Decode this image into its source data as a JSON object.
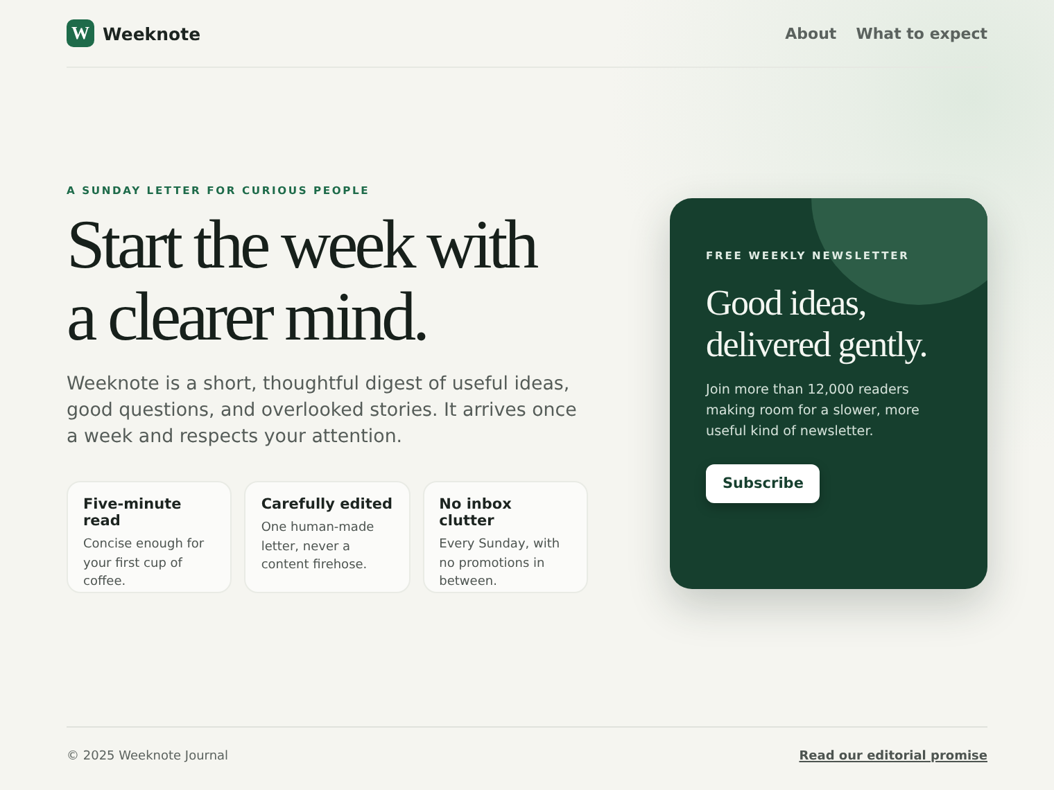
{
  "header": {
    "logo_letter": "W",
    "brand": "Weeknote",
    "nav": [
      "About",
      "What to expect"
    ]
  },
  "hero": {
    "eyebrow": "A SUNDAY LETTER FOR CURIOUS PEOPLE",
    "heading_lines": [
      "Start the week with",
      "a clearer mind."
    ],
    "intro": "Weeknote is a short, thoughtful digest of useful ideas, good questions, and overlooked stories. It arrives once a week and respects your attention.",
    "features": [
      {
        "title": "Five-minute read",
        "text": "Concise enough for your first cup of coffee."
      },
      {
        "title": "Carefully edited",
        "text": "One human-made letter, never a content firehose."
      },
      {
        "title": "No inbox clutter",
        "text": "Every Sunday, with no promotions in between."
      }
    ]
  },
  "signup": {
    "eyebrow": "FREE WEEKLY NEWSLETTER",
    "heading_lines": [
      "Good ideas,",
      "delivered gently."
    ],
    "text": "Join more than 12,000 readers making room for a slower, more useful kind of newsletter.",
    "button": "Subscribe"
  },
  "footer": {
    "copyright": "© 2025 Weeknote Journal",
    "link": "Read our editorial promise"
  }
}
